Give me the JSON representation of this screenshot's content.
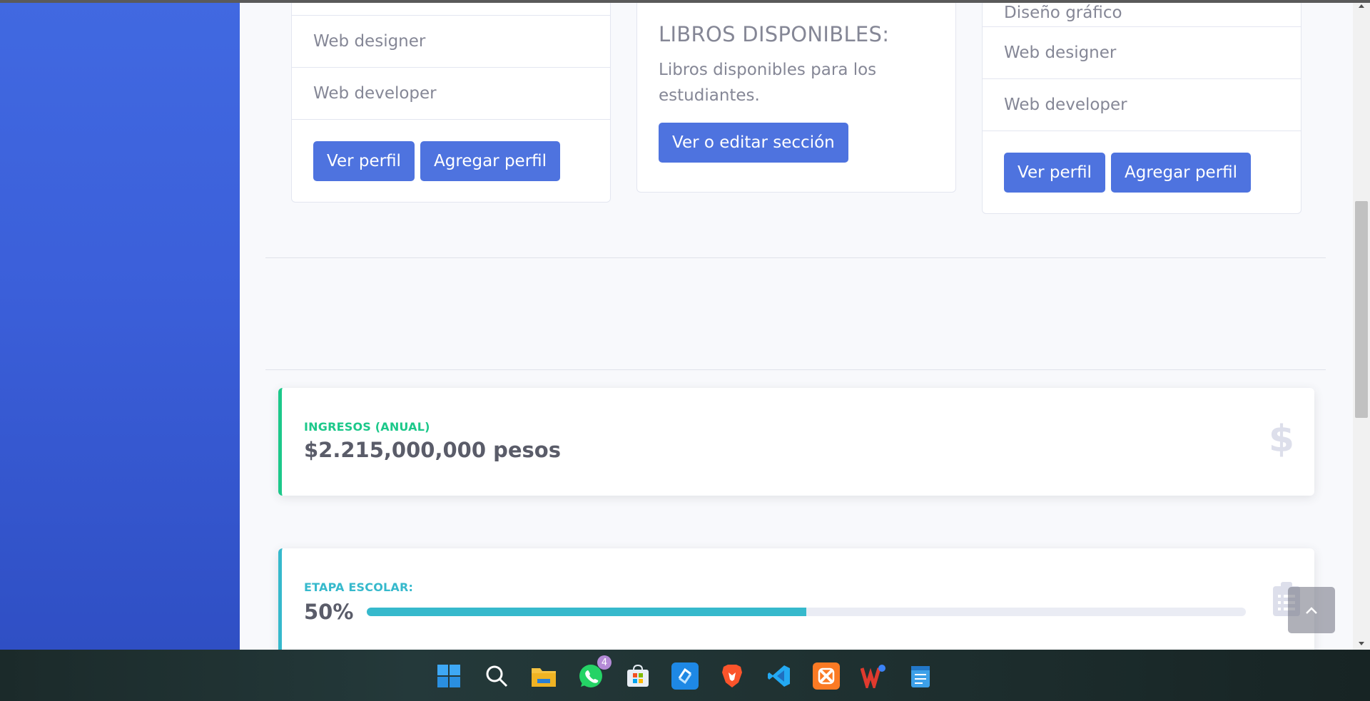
{
  "cards": {
    "left": {
      "items": [
        "Web designer",
        "Web developer"
      ],
      "view_profile": "Ver perfil",
      "add_profile": "Agregar perfil"
    },
    "middle": {
      "title": "LIBROS DISPONIBLES:",
      "text": "Libros disponibles para los estudiantes.",
      "edit_button": "Ver o editar sección"
    },
    "right": {
      "top_item_cut": "Diseño gráfico",
      "items": [
        "Web designer",
        "Web developer"
      ],
      "view_profile": "Ver perfil",
      "add_profile": "Agregar perfil"
    }
  },
  "income": {
    "label": "INGRESOS (ANUAL)",
    "value": "$2.215,000,000 pesos",
    "icon": "dollar-icon",
    "accent": "#1cc88a"
  },
  "stage": {
    "label": "ETAPA ESCOLAR:",
    "percent_text": "50%",
    "progress": 0.5,
    "icon": "clipboard-list-icon",
    "accent": "#36b9cc"
  },
  "taskbar": {
    "whatsapp_badge": "4",
    "apps": [
      "start-icon",
      "search-icon",
      "file-explorer-icon",
      "whatsapp-icon",
      "store-icon",
      "sync-app-icon",
      "brave-browser-icon",
      "vscode-icon",
      "xampp-icon",
      "wps-office-icon",
      "notepad-icon"
    ]
  },
  "colors": {
    "primary": "#4e73df",
    "sidebar": "#4169e1"
  }
}
